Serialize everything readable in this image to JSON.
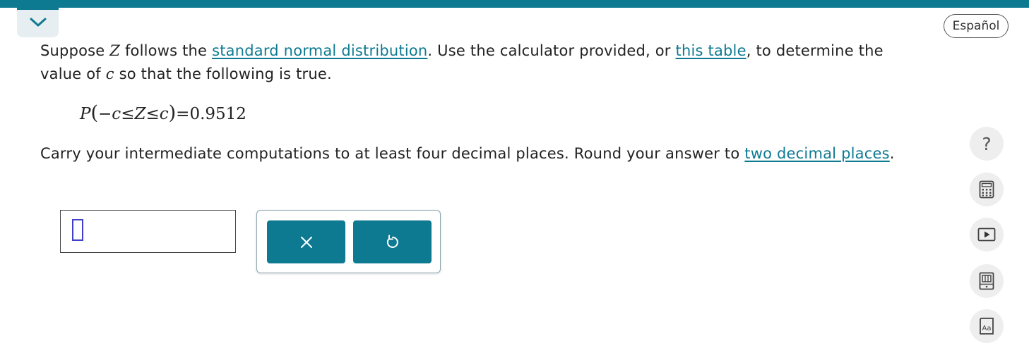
{
  "header": {
    "language_button": "Español"
  },
  "question": {
    "intro_1": "Suppose ",
    "var_z": "Z",
    "intro_2": " follows the ",
    "link_distribution": "standard normal distribution",
    "intro_3": ". Use the calculator provided, or ",
    "link_table": "this table",
    "intro_4": ", to determine the value of ",
    "var_c": "c",
    "intro_5": " so that the following is true."
  },
  "equation": {
    "p": "P",
    "open_paren": "(",
    "minus_c": "−c",
    "le_1": "≤",
    "z": "Z",
    "le_2": "≤",
    "c": "c",
    "close_paren": ")",
    "equals": "=",
    "value": "0.9512"
  },
  "instructions": {
    "text_1": "Carry your intermediate computations to at least four decimal places. Round your answer to ",
    "link_places": "two decimal places",
    "text_2": "."
  },
  "answer": {
    "value": ""
  },
  "actions": {
    "clear_icon": "close-icon",
    "undo_icon": "undo-icon"
  },
  "tools": {
    "help_glyph": "?",
    "icons": [
      "help-icon",
      "calculator-icon",
      "video-icon",
      "textbook-icon",
      "glossary-icon"
    ]
  },
  "colors": {
    "accent": "#0e7a92",
    "tool_bg": "#eeeeee",
    "input_cursor": "#4040c8"
  }
}
